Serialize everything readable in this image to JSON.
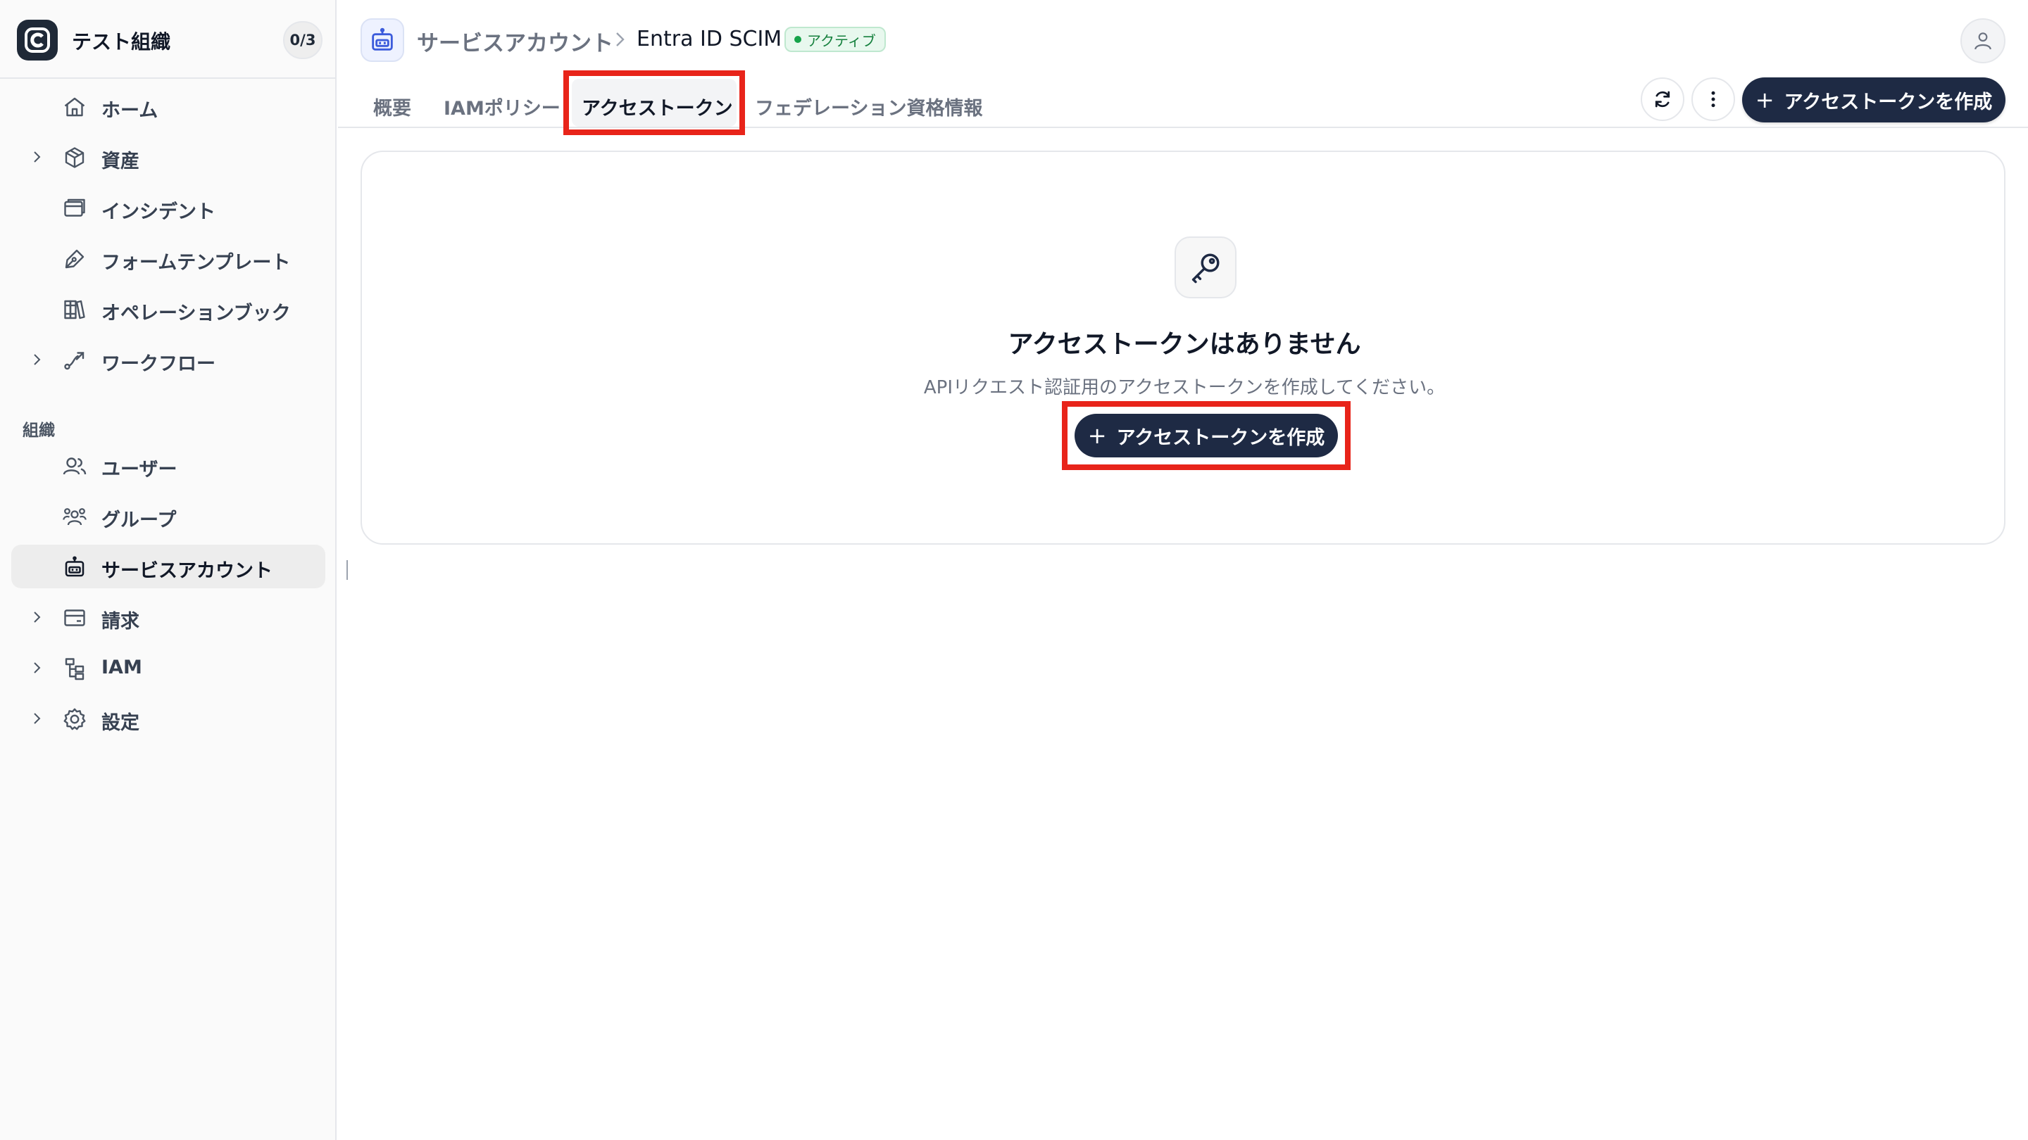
{
  "org": {
    "name": "テスト組織",
    "count": "0/3"
  },
  "sidebar": {
    "items": [
      {
        "label": "ホーム",
        "icon": "home-icon"
      },
      {
        "label": "資産",
        "icon": "box-icon"
      },
      {
        "label": "インシデント",
        "icon": "window-icon"
      },
      {
        "label": "フォームテンプレート",
        "icon": "pen-icon"
      },
      {
        "label": "オペレーションブック",
        "icon": "books-icon"
      },
      {
        "label": "ワークフロー",
        "icon": "workflow-icon"
      },
      {
        "label": "ユーザー",
        "icon": "users-icon"
      },
      {
        "label": "グループ",
        "icon": "group-icon"
      },
      {
        "label": "サービスアカウント",
        "icon": "bot-icon"
      },
      {
        "label": "請求",
        "icon": "card-icon"
      },
      {
        "label": "IAM",
        "icon": "tree-icon"
      },
      {
        "label": "設定",
        "icon": "gear-icon"
      }
    ],
    "section_label": "組織"
  },
  "header": {
    "breadcrumb_parent": "サービスアカウント",
    "breadcrumb_current": "Entra ID SCIM",
    "status": "アクティブ"
  },
  "tabs": [
    {
      "label": "概要"
    },
    {
      "label": "IAMポリシー"
    },
    {
      "label": "アクセストークン"
    },
    {
      "label": "フェデレーション資格情報"
    }
  ],
  "toolbar": {
    "create_label": "アクセストークンを作成"
  },
  "empty_state": {
    "title": "アクセストークンはありません",
    "description": "APIリクエスト認証用のアクセストークンを作成してください。",
    "cta_label": "アクセストークンを作成"
  },
  "colors": {
    "primary": "#1e2a44",
    "highlight": "#e8241a",
    "status_green": "#16a34a"
  }
}
